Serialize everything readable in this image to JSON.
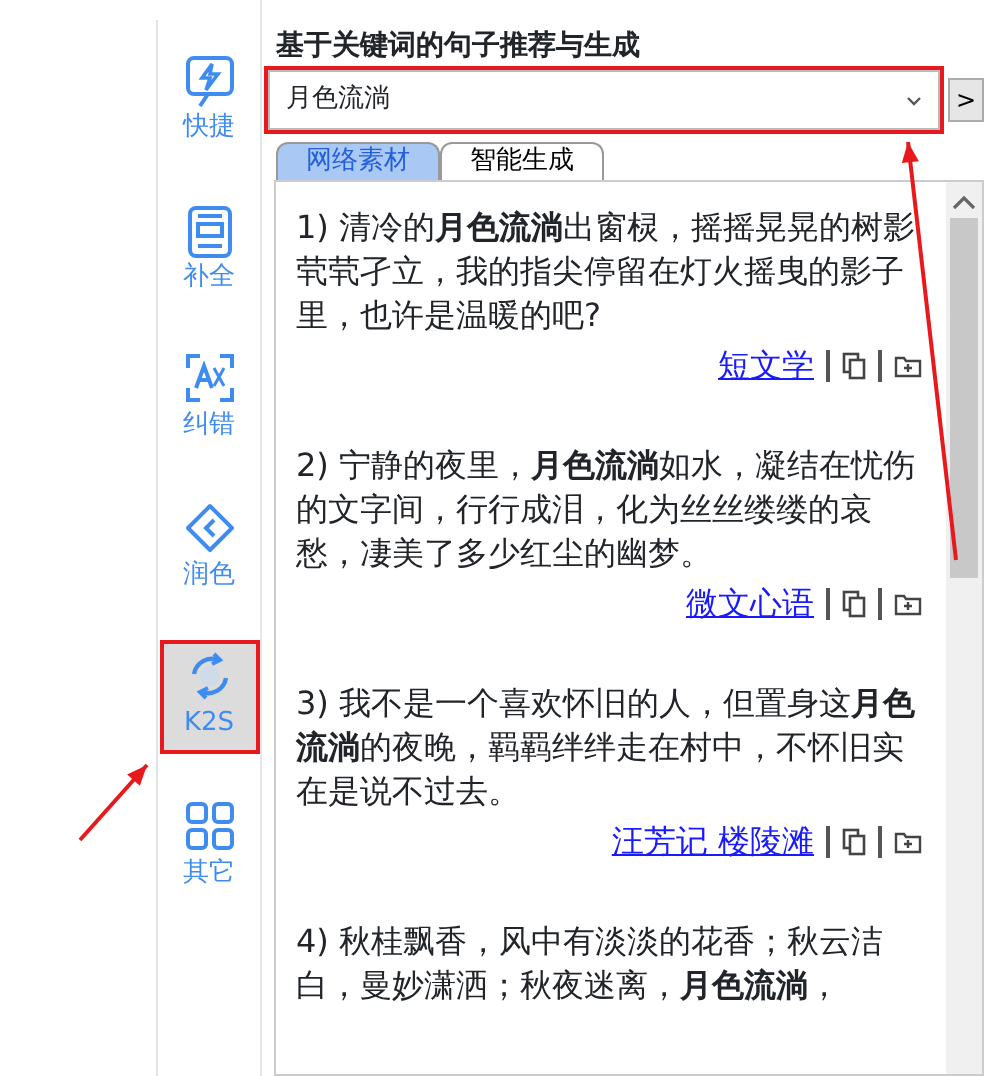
{
  "sidebar": {
    "items": [
      {
        "label": "快捷",
        "selected": false,
        "highlighted": false
      },
      {
        "label": "补全",
        "selected": false,
        "highlighted": false
      },
      {
        "label": "纠错",
        "selected": false,
        "highlighted": false
      },
      {
        "label": "润色",
        "selected": false,
        "highlighted": false
      },
      {
        "label": "K2S",
        "selected": true,
        "highlighted": true
      },
      {
        "label": "其它",
        "selected": false,
        "highlighted": false
      }
    ]
  },
  "panel": {
    "title": "基于关键词的句子推荐与生成",
    "keyword_select": {
      "value": "月色流淌",
      "highlighted": true
    },
    "go_button": ">",
    "tabs": [
      {
        "label": "网络素材",
        "selected": true
      },
      {
        "label": "智能生成",
        "selected": false
      }
    ],
    "results": [
      {
        "text": "1) 清冷的**月色流淌**出窗棂，摇摇晃晃的树影茕茕孑立，我的指尖停留在灯火摇曳的影子里，也许是温暖的吧?",
        "source": "短文学"
      },
      {
        "text": "2) 宁静的夜里，**月色流淌**如水，凝结在忧伤的文字间，行行成泪，化为丝丝缕缕的哀愁，凄美了多少红尘的幽梦。",
        "source": "微文心语"
      },
      {
        "text": "3) 我不是一个喜欢怀旧的人，但置身这**月色流淌**的夜晚，羁羁绊绊走在村中，不怀旧实在是说不过去。",
        "source": "汪芳记 楼陵滩"
      },
      {
        "text": "4) 秋桂飘香，风中有淡淡的花香；秋云洁白，曼妙潇洒；秋夜迷离，**月色流淌**，"
      }
    ]
  }
}
